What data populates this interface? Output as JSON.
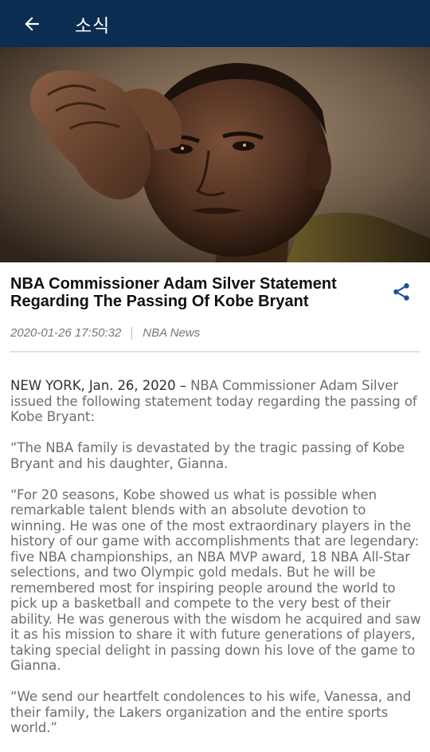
{
  "app_bar": {
    "title": "소식",
    "back_icon": "arrow-left-icon",
    "background": "#0c2d52"
  },
  "hero": {
    "subject": "portrait-photo"
  },
  "article": {
    "headline": "NBA Commissioner Adam Silver Statement Regarding The Passing Of Kobe Bryant",
    "share_icon": "share-icon",
    "share_color": "#1a4f9c",
    "timestamp": "2020-01-26 17:50:32",
    "source": "NBA News",
    "dateline": "NEW YORK, Jan. 26, 2020 –",
    "lead": " NBA Commissioner Adam Silver issued the following statement today regarding the passing of Kobe Bryant:",
    "paragraphs": [
      "“The NBA family is devastated by the tragic passing of Kobe Bryant and his daughter, Gianna.",
      "“For 20 seasons, Kobe showed us what is possible when remarkable talent blends with an absolute devotion to winning. He was one of the most extraordinary players in the history of our game with accomplishments that are legendary: five NBA championships, an NBA MVP award, 18 NBA All-Star selections, and two Olympic gold medals. But he will be remembered most for inspiring people around the world to pick up a basketball and compete to the very best of their ability. He was generous with the wisdom he acquired and saw it as his mission to share it with future generations of players, taking special delight in passing down his love of the game to Gianna.",
      "“We send our heartfelt condolences to his wife, Vanessa, and their family, the Lakers organization and the entire sports world.”"
    ]
  }
}
